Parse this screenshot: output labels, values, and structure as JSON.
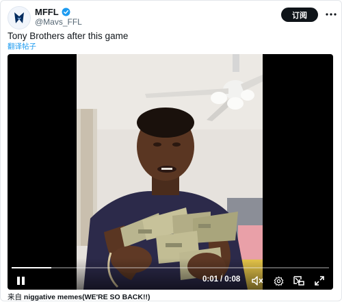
{
  "account": {
    "display_name": "MFFL",
    "handle": "@Mavs_FFL",
    "verified": true,
    "brand_color": "#002B5E",
    "verified_color": "#1d9bf0"
  },
  "actions": {
    "subscribe_label": "订阅",
    "more_icon": "more-dots-icon"
  },
  "tweet": {
    "text": "Tony Brothers after this game",
    "translate_label": "翻译帖子"
  },
  "video": {
    "current_time": "0:01",
    "separator": "/",
    "duration": "0:08",
    "progress_fraction": 0.125,
    "state": "playing"
  },
  "source": {
    "prefix": "来自",
    "name": "niggative memes(WE'RE SO BACK!!)"
  }
}
